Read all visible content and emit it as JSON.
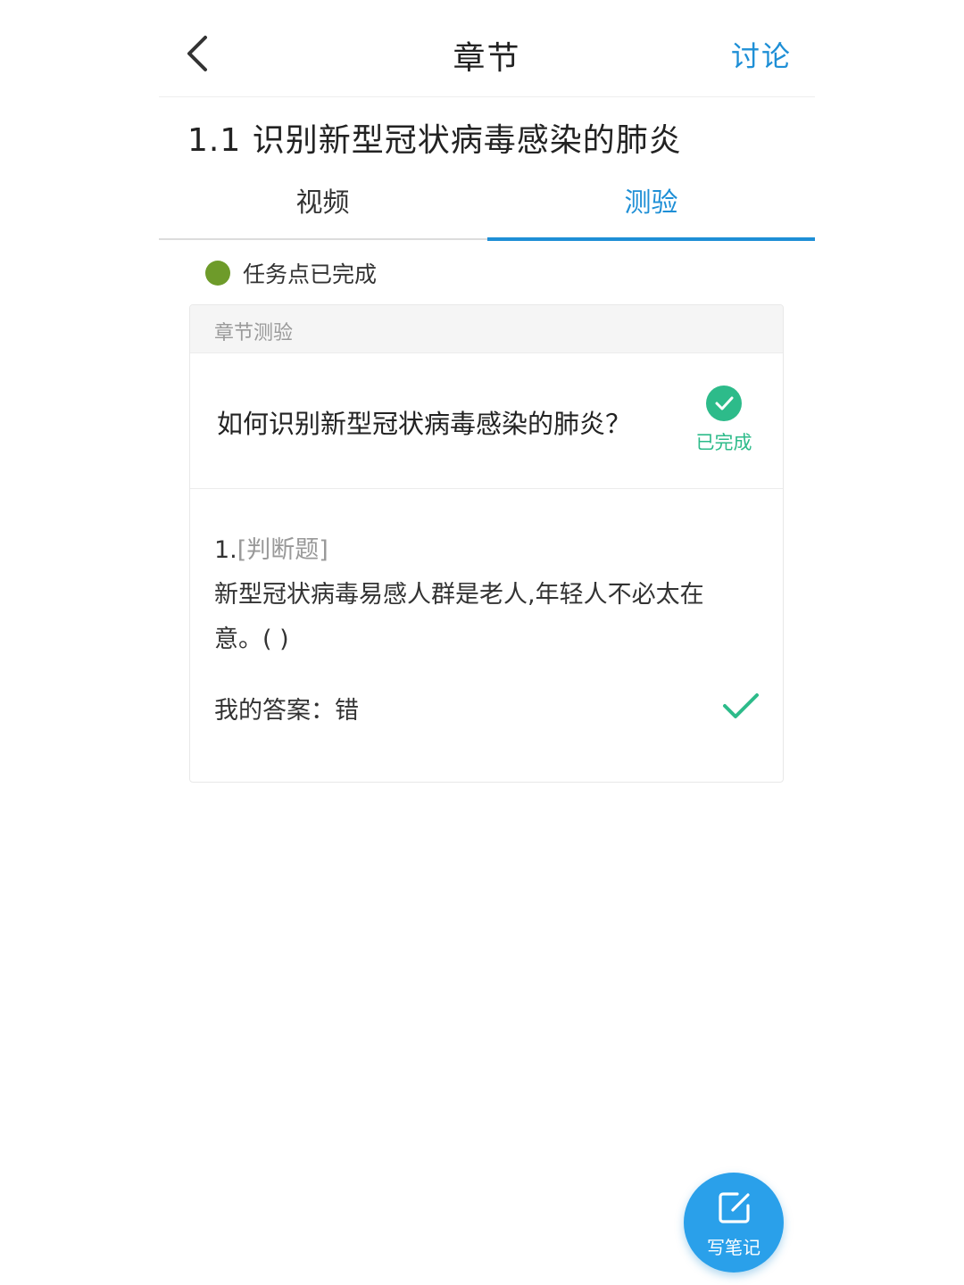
{
  "header": {
    "title": "章节",
    "discuss_label": "讨论"
  },
  "chapter": {
    "heading": "1.1 识别新型冠状病毒感染的肺炎"
  },
  "tabs": [
    {
      "label": "视频",
      "active": false
    },
    {
      "label": "测验",
      "active": true
    }
  ],
  "task": {
    "status_text": "任务点已完成",
    "status_color": "#6e9b2a"
  },
  "card": {
    "header_label": "章节测验",
    "quiz_title": "如何识别新型冠状病毒感染的肺炎？",
    "done_label": "已完成",
    "question": {
      "number": "1.",
      "type": "[判断题]",
      "text": "新型冠状病毒易感人群是老人,年轻人不必太在意。(   )"
    },
    "answer": {
      "label": "我的答案：",
      "value": "错",
      "correct": true
    }
  },
  "fab": {
    "label": "写笔记",
    "icon": "edit-note-icon"
  },
  "colors": {
    "accent": "#1e8fd6",
    "success": "#2dbb8a",
    "fab": "#2aa0ea"
  },
  "icons": {
    "back": "chevron-left-icon",
    "done": "check-circle-icon",
    "answer": "checkmark-icon"
  }
}
